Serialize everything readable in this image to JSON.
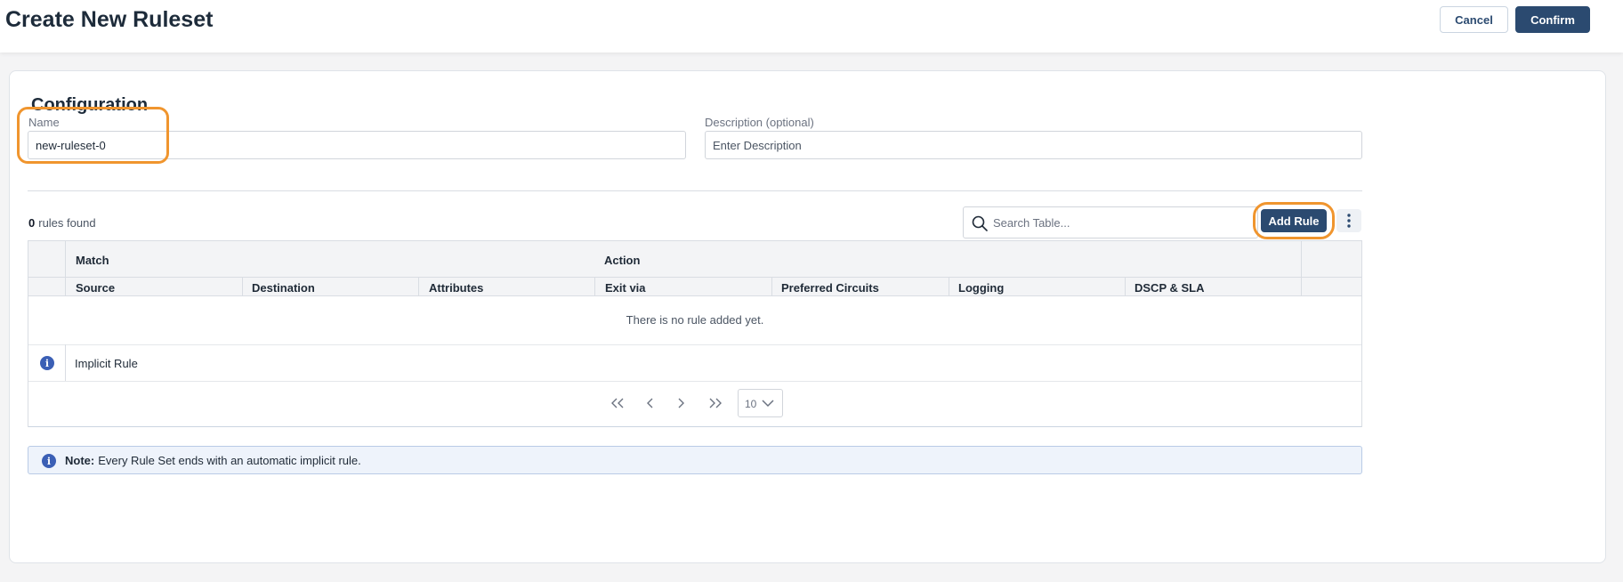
{
  "header": {
    "title": "Create New Ruleset",
    "cancel_label": "Cancel",
    "confirm_label": "Confirm"
  },
  "config": {
    "section_title": "Configuration",
    "name_label": "Name",
    "name_value": "new-ruleset-0",
    "description_label": "Description (optional)",
    "description_placeholder": "Enter Description"
  },
  "rules": {
    "count": "0",
    "count_suffix": "rules found",
    "search_placeholder": "Search Table...",
    "add_rule_label": "Add Rule"
  },
  "table": {
    "group_headers": [
      "Match",
      "Action"
    ],
    "columns": [
      "Source",
      "Destination",
      "Attributes",
      "Exit via",
      "Preferred Circuits",
      "Logging",
      "DSCP & SLA"
    ],
    "empty_message": "There is no rule added yet.",
    "implicit_rule_label": "Implicit Rule"
  },
  "pagination": {
    "page_size": "10"
  },
  "note": {
    "label": "Note:",
    "text": "Every Rule Set ends with an automatic implicit rule."
  },
  "colors": {
    "primary": "#2b4a70",
    "highlight": "#f0952e",
    "info": "#3b5fb5"
  }
}
